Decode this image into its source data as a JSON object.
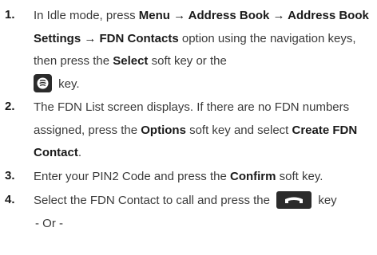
{
  "steps": [
    {
      "number": "1.",
      "seg": [
        "In Idle mode, press ",
        "Menu → Address Book → Address Book Settings → FDN Contacts",
        " option using the navigation keys, then press the ",
        "Select",
        " soft key or the ",
        " key."
      ],
      "icon": "select-key-icon"
    },
    {
      "number": "2.",
      "seg": [
        "The FDN List screen displays. If there are no FDN numbers assigned, press the ",
        "Options",
        " soft key and select ",
        "Create FDN Contact",
        "."
      ]
    },
    {
      "number": "3.",
      "seg": [
        "Enter your PIN2 Code and press the ",
        "Confirm",
        " soft key."
      ]
    },
    {
      "number": "4.",
      "seg": [
        "Select the FDN Contact to call and press the ",
        " key"
      ],
      "icon": "call-key-icon",
      "or_text": "- Or -"
    }
  ]
}
